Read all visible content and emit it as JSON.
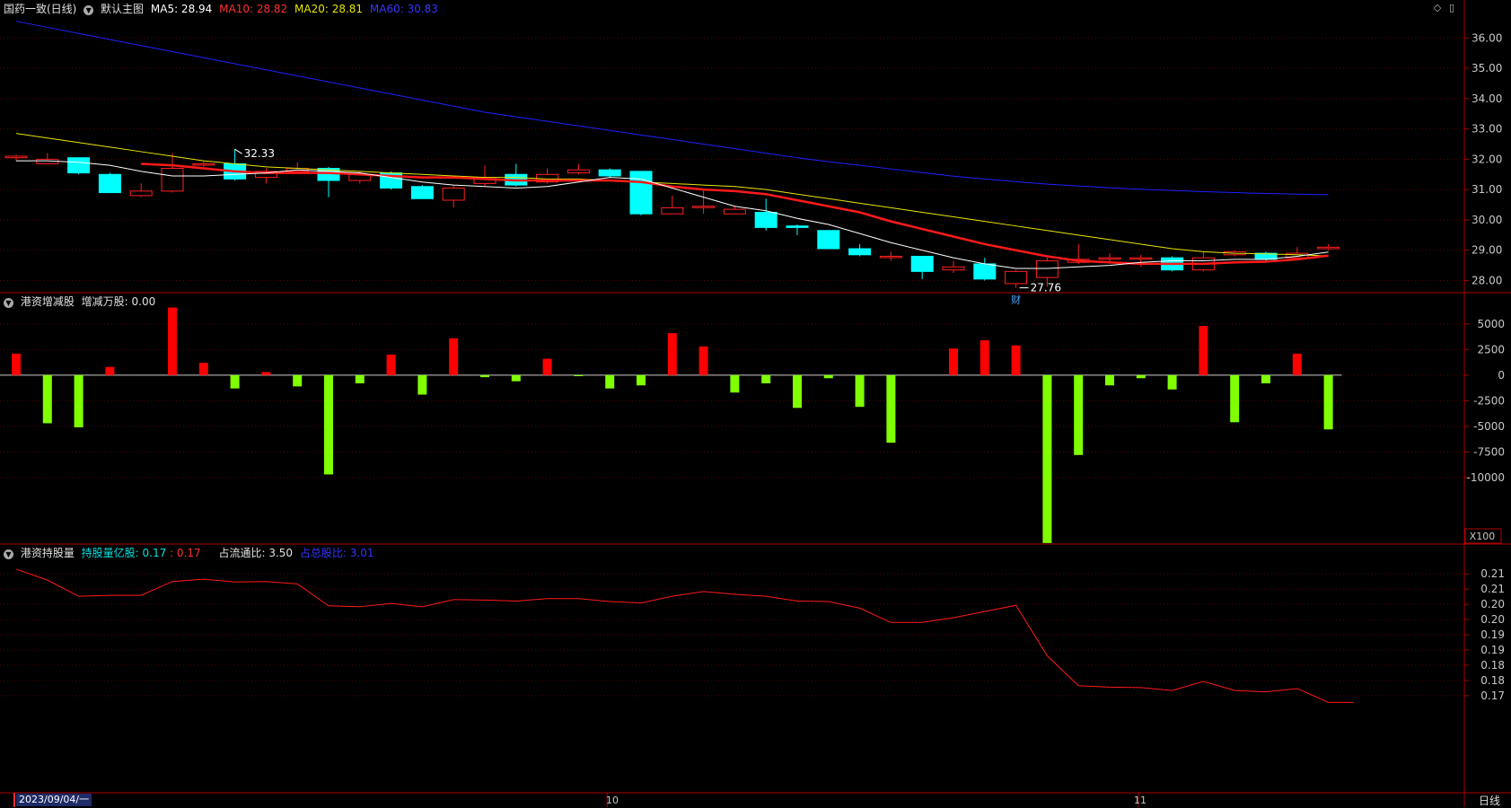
{
  "colors": {
    "up": "#ff2020",
    "down": "#00ffff",
    "ma5": "#ffffff",
    "ma10": "#ff1a1a",
    "ma20": "#e6e600",
    "ma60": "#2020ff",
    "bar_pos": "#ff0000",
    "bar_neg": "#80ff00",
    "grid": "#550000",
    "axis": "#aa0000",
    "text": "#c8c8c8"
  },
  "main": {
    "title": "国药一致(日线)",
    "indicator": "默认主图",
    "ma5_label": "MA5: 28.94",
    "ma10_label": "MA10: 28.82",
    "ma20_label": "MA20: 28.81",
    "ma60_label": "MA60: 30.83",
    "high_label": "32.33",
    "low_label": "27.76",
    "event_mark": "财",
    "yticks": [
      "36.00",
      "35.00",
      "34.00",
      "33.00",
      "32.00",
      "31.00",
      "30.00",
      "29.00",
      "28.00"
    ]
  },
  "vol": {
    "title": "港资增减股",
    "value_label": "增减万股: 0.00",
    "yticks": [
      "5000",
      "2500",
      "0",
      "-2500",
      "-5000",
      "-7500",
      "-10000"
    ],
    "unit_label": "X100"
  },
  "hold": {
    "title": "港资持股量",
    "shares_label": "持股量亿股: 0.17",
    "shares_value2": ": 0.17",
    "float_label": "占流通比: 3.50",
    "total_label": "占总股比: 3.01",
    "yticks": [
      "0.21",
      "0.21",
      "0.20",
      "0.20",
      "0.19",
      "0.19",
      "0.18",
      "0.18",
      "0.17"
    ]
  },
  "xaxis": {
    "date_label": "2023/09/04/一",
    "oct_label": "10",
    "nov_label": "11",
    "period": "日线"
  },
  "chart_data": [
    {
      "type": "candlestick",
      "title": "国药一致(日线)",
      "ylim": [
        27.6,
        36.6
      ],
      "candles": [
        {
          "o": 32.05,
          "c": 32.1,
          "h": 32.15,
          "l": 31.95
        },
        {
          "o": 31.85,
          "c": 32.0,
          "h": 32.2,
          "l": 31.85
        },
        {
          "o": 32.05,
          "c": 31.55,
          "h": 32.05,
          "l": 31.5
        },
        {
          "o": 31.5,
          "c": 30.9,
          "h": 31.55,
          "l": 30.9
        },
        {
          "o": 30.8,
          "c": 30.95,
          "h": 31.2,
          "l": 30.75
        },
        {
          "o": 30.95,
          "c": 31.7,
          "h": 32.2,
          "l": 30.9
        },
        {
          "o": 31.82,
          "c": 31.85,
          "h": 31.95,
          "l": 31.75
        },
        {
          "o": 31.85,
          "c": 31.35,
          "h": 32.33,
          "l": 31.3
        },
        {
          "o": 31.4,
          "c": 31.6,
          "h": 31.7,
          "l": 31.2
        },
        {
          "o": 31.6,
          "c": 31.7,
          "h": 31.9,
          "l": 31.55
        },
        {
          "o": 31.7,
          "c": 31.3,
          "h": 31.75,
          "l": 30.75
        },
        {
          "o": 31.3,
          "c": 31.5,
          "h": 31.6,
          "l": 31.2
        },
        {
          "o": 31.55,
          "c": 31.05,
          "h": 31.6,
          "l": 31.0
        },
        {
          "o": 31.1,
          "c": 30.7,
          "h": 31.15,
          "l": 30.7
        },
        {
          "o": 30.65,
          "c": 31.05,
          "h": 31.15,
          "l": 30.4
        },
        {
          "o": 31.2,
          "c": 31.4,
          "h": 31.8,
          "l": 31.1
        },
        {
          "o": 31.5,
          "c": 31.15,
          "h": 31.85,
          "l": 31.1
        },
        {
          "o": 31.25,
          "c": 31.5,
          "h": 31.7,
          "l": 31.2
        },
        {
          "o": 31.55,
          "c": 31.65,
          "h": 31.85,
          "l": 31.5
        },
        {
          "o": 31.65,
          "c": 31.45,
          "h": 31.7,
          "l": 31.4
        },
        {
          "o": 31.6,
          "c": 30.2,
          "h": 31.6,
          "l": 30.15
        },
        {
          "o": 30.2,
          "c": 30.4,
          "h": 30.8,
          "l": 30.2
        },
        {
          "o": 30.45,
          "c": 30.45,
          "h": 31.0,
          "l": 30.2
        },
        {
          "o": 30.2,
          "c": 30.35,
          "h": 30.45,
          "l": 30.2
        },
        {
          "o": 30.25,
          "c": 29.75,
          "h": 30.7,
          "l": 29.65
        },
        {
          "o": 29.8,
          "c": 29.75,
          "h": 29.85,
          "l": 29.5
        },
        {
          "o": 29.65,
          "c": 29.05,
          "h": 29.65,
          "l": 29.05
        },
        {
          "o": 29.05,
          "c": 28.85,
          "h": 29.2,
          "l": 28.8
        },
        {
          "o": 28.8,
          "c": 28.8,
          "h": 28.95,
          "l": 28.65
        },
        {
          "o": 28.8,
          "c": 28.3,
          "h": 28.8,
          "l": 28.05
        },
        {
          "o": 28.35,
          "c": 28.45,
          "h": 28.65,
          "l": 28.25
        },
        {
          "o": 28.55,
          "c": 28.05,
          "h": 28.75,
          "l": 28.0
        },
        {
          "o": 27.9,
          "c": 28.3,
          "h": 28.35,
          "l": 27.76
        },
        {
          "o": 28.1,
          "c": 28.65,
          "h": 28.75,
          "l": 27.8
        },
        {
          "o": 28.6,
          "c": 28.7,
          "h": 29.2,
          "l": 28.55
        },
        {
          "o": 28.75,
          "c": 28.75,
          "h": 28.9,
          "l": 28.55
        },
        {
          "o": 28.75,
          "c": 28.75,
          "h": 28.85,
          "l": 28.45
        },
        {
          "o": 28.75,
          "c": 28.35,
          "h": 28.8,
          "l": 28.3
        },
        {
          "o": 28.35,
          "c": 28.75,
          "h": 28.95,
          "l": 28.3
        },
        {
          "o": 28.85,
          "c": 28.95,
          "h": 29.0,
          "l": 28.8
        },
        {
          "o": 28.9,
          "c": 28.7,
          "h": 28.95,
          "l": 28.65
        },
        {
          "o": 28.75,
          "c": 28.9,
          "h": 29.1,
          "l": 28.7
        },
        {
          "o": 29.05,
          "c": 29.1,
          "h": 29.2,
          "l": 29.0
        }
      ],
      "ma5": [
        31.95,
        31.95,
        31.9,
        31.8,
        31.6,
        31.45,
        31.45,
        31.5,
        31.55,
        31.65,
        31.6,
        31.55,
        31.4,
        31.25,
        31.15,
        31.1,
        31.05,
        31.1,
        31.25,
        31.4,
        31.35,
        31.05,
        30.75,
        30.45,
        30.3,
        30.05,
        29.85,
        29.55,
        29.25,
        29.0,
        28.75,
        28.55,
        28.4,
        28.4,
        28.45,
        28.5,
        28.6,
        28.65,
        28.65,
        28.7,
        28.7,
        28.8,
        28.94
      ],
      "ma10": [
        null,
        null,
        null,
        null,
        31.85,
        31.8,
        31.7,
        31.6,
        31.55,
        31.55,
        31.55,
        31.5,
        31.45,
        31.4,
        31.4,
        31.35,
        31.3,
        31.3,
        31.3,
        31.3,
        31.25,
        31.1,
        31.0,
        30.95,
        30.85,
        30.65,
        30.45,
        30.25,
        29.95,
        29.7,
        29.45,
        29.2,
        29.0,
        28.8,
        28.65,
        28.6,
        28.55,
        28.55,
        28.55,
        28.6,
        28.62,
        28.7,
        28.82
      ],
      "ma20": [
        32.85,
        32.7,
        32.55,
        32.4,
        32.25,
        32.1,
        31.95,
        31.85,
        31.75,
        31.7,
        31.65,
        31.6,
        31.55,
        31.5,
        31.45,
        31.4,
        31.4,
        31.35,
        31.35,
        31.3,
        31.25,
        31.2,
        31.15,
        31.1,
        31.0,
        30.85,
        30.7,
        30.55,
        30.4,
        30.25,
        30.1,
        29.95,
        29.8,
        29.65,
        29.5,
        29.35,
        29.2,
        29.05,
        28.95,
        28.9,
        28.88,
        28.85,
        28.81
      ],
      "ma60": [
        36.55,
        36.35,
        36.15,
        35.95,
        35.75,
        35.55,
        35.35,
        35.15,
        34.95,
        34.75,
        34.55,
        34.35,
        34.15,
        33.95,
        33.75,
        33.55,
        33.4,
        33.25,
        33.1,
        32.95,
        32.8,
        32.65,
        32.5,
        32.35,
        32.2,
        32.05,
        31.92,
        31.8,
        31.68,
        31.56,
        31.44,
        31.35,
        31.26,
        31.18,
        31.12,
        31.06,
        31.01,
        30.97,
        30.93,
        30.9,
        30.87,
        30.85,
        30.83
      ]
    },
    {
      "type": "bar",
      "title": "港资增减股",
      "ylim": [
        -16500,
        6300
      ],
      "values": [
        2100,
        -4700,
        -5100,
        800,
        0,
        6600,
        1200,
        -1300,
        300,
        -1100,
        -9700,
        -800,
        2000,
        -1900,
        3600,
        -200,
        -600,
        1600,
        -100,
        -1300,
        -1000,
        4100,
        2800,
        -1700,
        -800,
        -3200,
        -300,
        -3100,
        -6600,
        0,
        2600,
        3400,
        2900,
        -16400,
        -7800,
        -1000,
        -300,
        -1400,
        4800,
        -4600,
        -800,
        2100,
        -5300
      ]
    },
    {
      "type": "line",
      "title": "港资持股量",
      "ylim": [
        0.168,
        0.2165
      ],
      "values": [
        0.215,
        0.2127,
        0.2093,
        0.2095,
        0.2095,
        0.2124,
        0.2129,
        0.2123,
        0.2124,
        0.2119,
        0.2073,
        0.2071,
        0.2078,
        0.2071,
        0.2086,
        0.2085,
        0.2083,
        0.2088,
        0.2088,
        0.2082,
        0.2079,
        0.2093,
        0.2103,
        0.2097,
        0.2093,
        0.2083,
        0.2082,
        0.2068,
        0.2038,
        0.2038,
        0.2048,
        0.2061,
        0.2074,
        0.1968,
        0.1905,
        0.1902,
        0.1901,
        0.1895,
        0.1914,
        0.1895,
        0.1892,
        0.1899,
        0.187,
        0.187
      ]
    }
  ]
}
